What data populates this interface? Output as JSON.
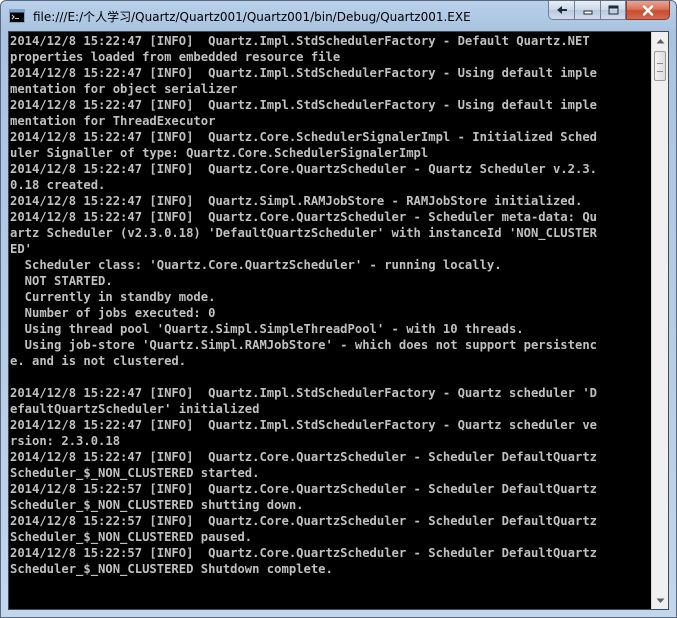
{
  "window": {
    "title": "file:///E:/个人学习/Quartz/Quartz001/Quartz001/bin/Debug/Quartz001.EXE",
    "icon": "console-app-icon",
    "caption_buttons": [
      "restore-down",
      "minimize",
      "maximize",
      "close"
    ]
  },
  "console": {
    "background": "#000000",
    "foreground": "#c0c0c0",
    "lines": [
      "2014/12/8 15:22:47 [INFO]  Quartz.Impl.StdSchedulerFactory - Default Quartz.NET",
      "properties loaded from embedded resource file",
      "2014/12/8 15:22:47 [INFO]  Quartz.Impl.StdSchedulerFactory - Using default imple",
      "mentation for object serializer",
      "2014/12/8 15:22:47 [INFO]  Quartz.Impl.StdSchedulerFactory - Using default imple",
      "mentation for ThreadExecutor",
      "2014/12/8 15:22:47 [INFO]  Quartz.Core.SchedulerSignalerImpl - Initialized Sched",
      "uler Signaller of type: Quartz.Core.SchedulerSignalerImpl",
      "2014/12/8 15:22:47 [INFO]  Quartz.Core.QuartzScheduler - Quartz Scheduler v.2.3.",
      "0.18 created.",
      "2014/12/8 15:22:47 [INFO]  Quartz.Simpl.RAMJobStore - RAMJobStore initialized.",
      "2014/12/8 15:22:47 [INFO]  Quartz.Core.QuartzScheduler - Scheduler meta-data: Qu",
      "artz Scheduler (v2.3.0.18) 'DefaultQuartzScheduler' with instanceId 'NON_CLUSTER",
      "ED'",
      "  Scheduler class: 'Quartz.Core.QuartzScheduler' - running locally.",
      "  NOT STARTED.",
      "  Currently in standby mode.",
      "  Number of jobs executed: 0",
      "  Using thread pool 'Quartz.Simpl.SimpleThreadPool' - with 10 threads.",
      "  Using job-store 'Quartz.Simpl.RAMJobStore' - which does not support persistenc",
      "e. and is not clustered.",
      "",
      "2014/12/8 15:22:47 [INFO]  Quartz.Impl.StdSchedulerFactory - Quartz scheduler 'D",
      "efaultQuartzScheduler' initialized",
      "2014/12/8 15:22:47 [INFO]  Quartz.Impl.StdSchedulerFactory - Quartz scheduler ve",
      "rsion: 2.3.0.18",
      "2014/12/8 15:22:47 [INFO]  Quartz.Core.QuartzScheduler - Scheduler DefaultQuartz",
      "Scheduler_$_NON_CLUSTERED started.",
      "2014/12/8 15:22:57 [INFO]  Quartz.Core.QuartzScheduler - Scheduler DefaultQuartz",
      "Scheduler_$_NON_CLUSTERED shutting down.",
      "2014/12/8 15:22:57 [INFO]  Quartz.Core.QuartzScheduler - Scheduler DefaultQuartz",
      "Scheduler_$_NON_CLUSTERED paused.",
      "2014/12/8 15:22:57 [INFO]  Quartz.Core.QuartzScheduler - Scheduler DefaultQuartz",
      "Scheduler_$_NON_CLUSTERED Shutdown complete."
    ]
  },
  "scrollbar": {
    "position": 0,
    "up_arrow_icon": "scroll-up-arrow-icon",
    "down_arrow_icon": "scroll-down-arrow-icon"
  }
}
